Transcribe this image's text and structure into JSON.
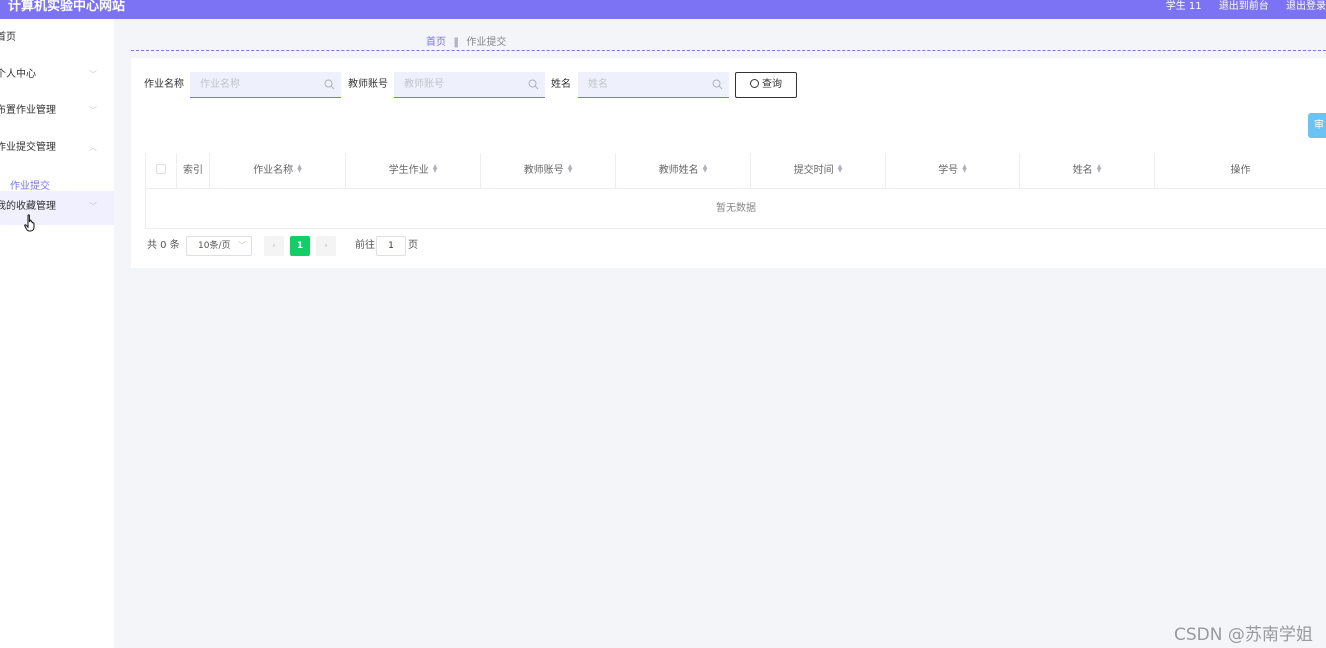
{
  "app": {
    "title": "计算机实验中心网站"
  },
  "topbar": {
    "user": "学生 11",
    "exit_front": "退出到前台",
    "logout": "退出登录"
  },
  "sidebar": {
    "items": [
      {
        "label": "首页"
      },
      {
        "label": "个人中心"
      },
      {
        "label": "布置作业管理"
      },
      {
        "label": "作业提交管理"
      },
      {
        "label": "我的收藏管理"
      }
    ],
    "submenu": {
      "label": "作业提交"
    }
  },
  "breadcrumb": {
    "home": "首页",
    "current": "作业提交"
  },
  "search": {
    "fields": [
      {
        "label": "作业名称",
        "placeholder": "作业名称"
      },
      {
        "label": "教师账号",
        "placeholder": "教师账号"
      },
      {
        "label": "姓名",
        "placeholder": "姓名"
      }
    ],
    "query_label": "查询"
  },
  "corner_button": {
    "label": "审核"
  },
  "table": {
    "columns": [
      "索引",
      "作业名称",
      "学生作业",
      "教师账号",
      "教师姓名",
      "提交时间",
      "学号",
      "姓名",
      "操作"
    ],
    "empty_text": "暂无数据"
  },
  "pagination": {
    "total": "共 0 条",
    "page_size": "10条/页",
    "current_page": "1",
    "goto_label": "前往",
    "goto_value": "1",
    "page_suffix": "页"
  },
  "watermark": "CSDN @苏南学姐",
  "colors": {
    "accent": "#7b73f4",
    "active_page": "#13ce66",
    "corner_button": "#6bc3f3"
  }
}
